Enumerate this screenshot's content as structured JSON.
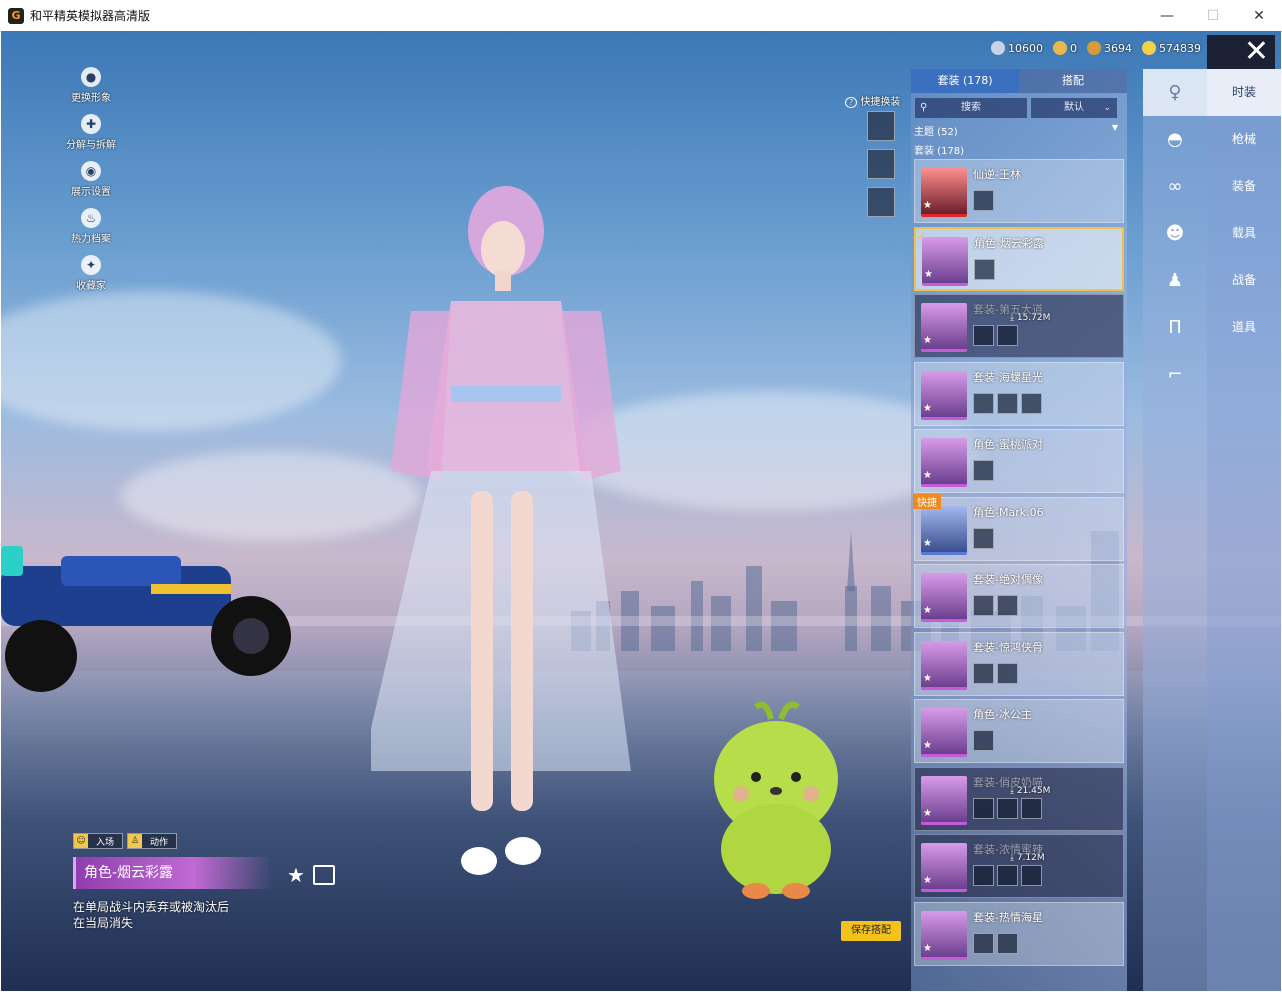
{
  "window": {
    "title": "和平精英模拟器高清版",
    "icon_glyph": "G",
    "minimize": "—",
    "maximize": "☐",
    "close": "✕"
  },
  "currency": [
    {
      "value": "10600",
      "color": "#c9d3e6"
    },
    {
      "value": "0",
      "color": "#e8b84a"
    },
    {
      "value": "3694",
      "color": "#d89a3a"
    },
    {
      "value": "574839",
      "color": "#f3d24a"
    }
  ],
  "game_close": "✕",
  "left_menu": [
    {
      "label": "更换形象",
      "icon": "person-icon",
      "glyph": "●"
    },
    {
      "label": "分解与拆解",
      "icon": "puzzle-icon",
      "glyph": "✚"
    },
    {
      "label": "展示设置",
      "icon": "eye-icon",
      "glyph": "◉"
    },
    {
      "label": "热力档案",
      "icon": "flame-icon",
      "glyph": "♨"
    },
    {
      "label": "收藏家",
      "icon": "badge-icon",
      "glyph": "✦"
    }
  ],
  "quick_swap": {
    "label": "快捷换装",
    "help_glyph": "?"
  },
  "tags": [
    {
      "label": "入场",
      "icon": "face-icon"
    },
    {
      "label": "动作",
      "icon": "person-icon"
    }
  ],
  "selected_item": {
    "name": "角色-烟云彩露",
    "description": "在单局战斗内丢弃或被淘汰后在当局消失"
  },
  "fav_glyph": "★",
  "save_button": "保存搭配",
  "panel": {
    "tabs": [
      {
        "label": "套装 (178)",
        "active": true
      },
      {
        "label": "搭配",
        "active": false
      }
    ],
    "search_placeholder": "搜索",
    "sort_label": "默认",
    "theme_section": "主题 (52)",
    "outfit_section": "套装 (178)",
    "cards": [
      {
        "name": "仙逆-王林",
        "thumb": "legend",
        "parts": 1,
        "selected": false,
        "dim": false
      },
      {
        "name": "角色-烟云彩露",
        "thumb": "purple",
        "parts": 1,
        "selected": true,
        "dim": false
      },
      {
        "name": "套装-第五大道",
        "thumb": "purple",
        "parts": 2,
        "selected": false,
        "dim": true,
        "download": "15.72M"
      },
      {
        "name": "套装-海螺星光",
        "thumb": "purple",
        "parts": 3,
        "selected": false,
        "dim": false
      },
      {
        "name": "角色-蜜桃派对",
        "thumb": "purple",
        "parts": 1,
        "selected": false,
        "dim": false
      },
      {
        "name": "角色-Mark.06",
        "thumb": "blue",
        "parts": 1,
        "selected": false,
        "dim": false,
        "badge": "快捷"
      },
      {
        "name": "套装-绝对偶像",
        "thumb": "purple",
        "parts": 2,
        "selected": false,
        "dim": false
      },
      {
        "name": "套装-惊鸿侠骨",
        "thumb": "purple",
        "parts": 2,
        "selected": false,
        "dim": false
      },
      {
        "name": "角色-冰公主",
        "thumb": "purple",
        "parts": 1,
        "selected": false,
        "dim": false
      },
      {
        "name": "套装-俏皮奶喵",
        "thumb": "purple",
        "parts": 3,
        "selected": false,
        "dim": true,
        "download": "21.45M"
      },
      {
        "name": "套装-浓情蜜辣",
        "thumb": "purple",
        "parts": 3,
        "selected": false,
        "dim": true,
        "download": "7.12M"
      },
      {
        "name": "套装-热情海星",
        "thumb": "purple",
        "parts": 2,
        "selected": false,
        "dim": false
      }
    ]
  },
  "icon_column": [
    {
      "icon": "outfit-icon",
      "glyph": "♀",
      "active": true
    },
    {
      "icon": "cap-icon",
      "glyph": "◓",
      "active": false
    },
    {
      "icon": "glasses-icon",
      "glyph": "∞",
      "active": false
    },
    {
      "icon": "mask-icon",
      "glyph": "☻",
      "active": false
    },
    {
      "icon": "top-icon",
      "glyph": "♟",
      "active": false
    },
    {
      "icon": "pants-icon",
      "glyph": "Π",
      "active": false
    },
    {
      "icon": "shoes-icon",
      "glyph": "⌐",
      "active": false
    }
  ],
  "categories": [
    {
      "label": "时装",
      "active": true
    },
    {
      "label": "枪械",
      "active": false
    },
    {
      "label": "装备",
      "active": false
    },
    {
      "label": "载具",
      "active": false
    },
    {
      "label": "战备",
      "active": false
    },
    {
      "label": "道具",
      "active": false
    }
  ]
}
